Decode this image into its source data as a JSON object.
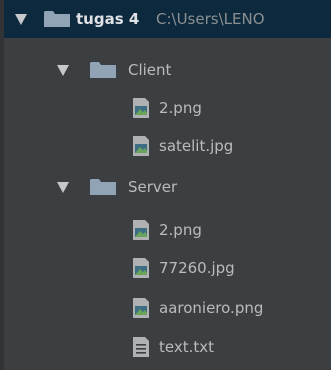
{
  "tree": {
    "root": {
      "label": "tugas 4",
      "path": "C:\\Users\\LENO"
    },
    "folders": [
      {
        "label": "Client",
        "files": [
          {
            "label": "2.png",
            "icon": "image-file-icon"
          },
          {
            "label": "satelit.jpg",
            "icon": "image-file-icon"
          }
        ]
      },
      {
        "label": "Server",
        "files": [
          {
            "label": "2.png",
            "icon": "image-file-icon"
          },
          {
            "label": "77260.jpg",
            "icon": "image-file-icon"
          },
          {
            "label": "aaroniero.png",
            "icon": "image-file-icon"
          },
          {
            "label": "text.txt",
            "icon": "text-file-icon"
          }
        ]
      }
    ]
  },
  "colors": {
    "background": "#3c3f41",
    "selection": "#0d293e",
    "text": "#bbbbbb",
    "folder": "#90a4b5"
  }
}
